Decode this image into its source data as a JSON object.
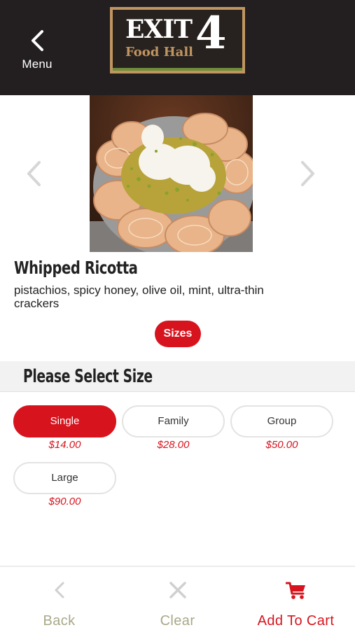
{
  "header": {
    "back_label": "Menu",
    "logo": {
      "line1": "EXIT",
      "number": "4",
      "line2": "Food Hall"
    }
  },
  "item": {
    "photo_icon": "whipped-ricotta-photo",
    "name": "Whipped Ricotta",
    "description": "pistachios, spicy honey, olive oil, mint, ultra-thin crackers",
    "sizes_label": "Sizes"
  },
  "size_section": {
    "heading": "Please Select Size",
    "options": [
      {
        "label": "Single",
        "price": "$14.00",
        "selected": true
      },
      {
        "label": "Family",
        "price": "$28.00",
        "selected": false
      },
      {
        "label": "Group",
        "price": "$50.00",
        "selected": false
      },
      {
        "label": "Large",
        "price": "$90.00",
        "selected": false
      }
    ]
  },
  "footer": {
    "back_label": "Back",
    "clear_label": "Clear",
    "cart_label": "Add To Cart"
  },
  "colors": {
    "accent": "#d7141e",
    "header_bg": "#231f20",
    "logo_gold": "#c09560",
    "muted": "#a9a889"
  }
}
